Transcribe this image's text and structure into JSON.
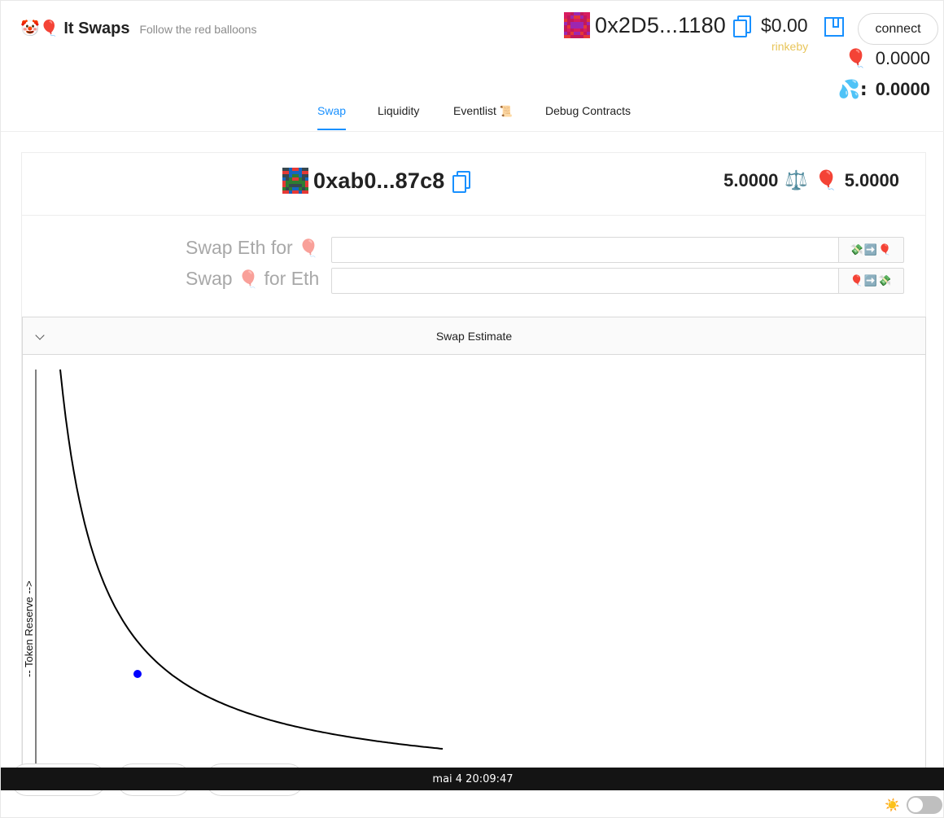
{
  "header": {
    "brand_emoji": "🤡🎈",
    "title": "It Swaps",
    "subtitle": "Follow the red balloons"
  },
  "account": {
    "address": "0x2D5...1180",
    "balance_usd": "$0.00",
    "network": "rinkeby",
    "connect_label": "connect"
  },
  "balances": [
    {
      "icon": "🎈",
      "icon_name": "balloon-icon",
      "value": "0.0000"
    },
    {
      "icon": "💦:",
      "icon_name": "sweat-drops-icon",
      "value": "0.0000"
    }
  ],
  "tabs": [
    {
      "label": "Swap",
      "active": true
    },
    {
      "label": "Liquidity",
      "active": false
    },
    {
      "label": "Eventlist",
      "emoji": "📜",
      "active": false
    },
    {
      "label": "Debug Contracts",
      "active": false
    }
  ],
  "dex": {
    "contract_address": "0xab0...87c8",
    "eth_reserve": "5.0000",
    "scale_icon": "⚖️",
    "balloon_icon": "🎈",
    "token_reserve": "5.0000"
  },
  "swap": {
    "eth_for_token_label": "Swap Eth for",
    "eth_for_token_emoji": "🎈",
    "eth_for_token_button": "💸➡️🎈",
    "token_for_eth_label_pre": "Swap",
    "token_for_eth_emoji": "🎈",
    "token_for_eth_label_post": "for Eth",
    "token_for_eth_button": "🎈➡️💸",
    "eth_for_token_value": "",
    "token_for_eth_value": ""
  },
  "estimate": {
    "title": "Swap Estimate",
    "y_axis_label": "-- Token Reserve -->"
  },
  "chart_data": {
    "type": "line",
    "title": "",
    "xlabel": "",
    "ylabel": "-- Token Reserve -->",
    "curve": "x * y = k",
    "k": 25,
    "x_range": [
      0.5,
      5.0
    ],
    "current_point": {
      "x": 5.0,
      "y": 5.0
    },
    "line_color": "#000000",
    "point_color": "#0000ff"
  },
  "taskbar": {
    "clock": "mai 4  20:09:47"
  },
  "theme": {
    "sun_icon": "☀️"
  },
  "colors": {
    "accent": "#1890ff",
    "network": "#e8c55a",
    "muted_label": "#a8a8a8"
  }
}
